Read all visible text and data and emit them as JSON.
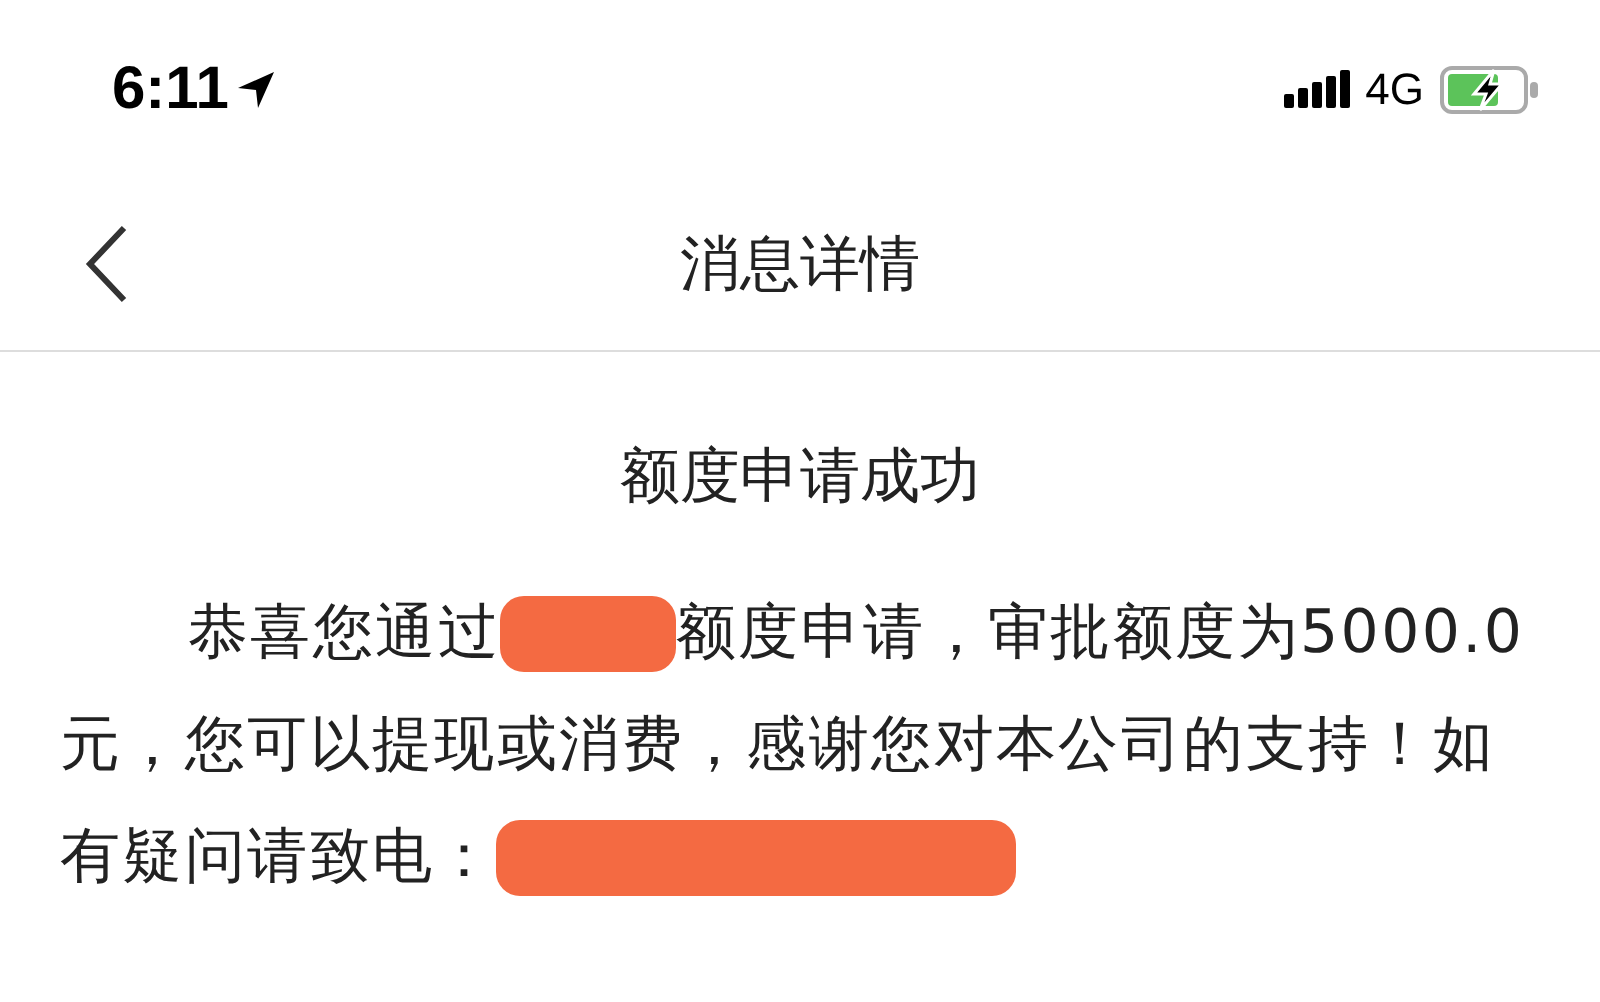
{
  "status_bar": {
    "time": "6:11",
    "network": "4G"
  },
  "nav": {
    "title": "消息详情"
  },
  "message": {
    "title": "额度申请成功",
    "lines": [
      [
        {
          "kind": "text",
          "text": "恭喜您通过"
        },
        {
          "kind": "redaction"
        },
        {
          "kind": "text",
          "text": "额度申请，审批额度为5000.0"
        }
      ],
      [
        {
          "kind": "text",
          "text": "元，您可以提现或消费，感谢您对本公司的支持！如"
        }
      ],
      [
        {
          "kind": "text",
          "text": "有疑问请致电："
        },
        {
          "kind": "redaction"
        }
      ]
    ]
  }
}
